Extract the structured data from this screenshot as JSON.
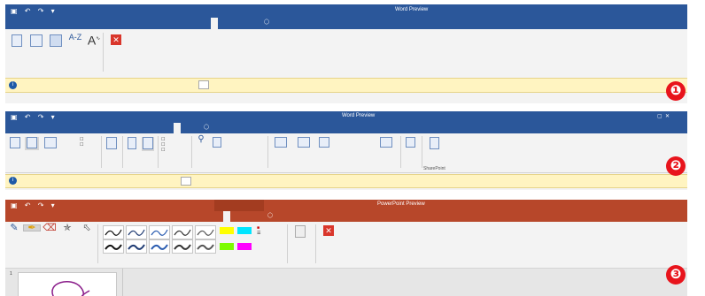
{
  "panel1": {
    "title": "Word Preview",
    "context_header": "",
    "tabs": [
      "",
      "",
      "",
      "",
      "",
      "",
      "",
      "",
      ""
    ],
    "tell_me": "",
    "ribbon": {
      "buttons": [
        "",
        "",
        "",
        "",
        "",
        ""
      ],
      "groups": [
        "",
        ""
      ]
    },
    "message": {
      "label": "",
      "text": "",
      "button": ""
    },
    "badge": "❶"
  },
  "panel2": {
    "title": "Word Preview",
    "tabs": [
      "",
      "",
      "",
      "",
      "",
      "",
      "",
      "",
      ""
    ],
    "tell_me": "",
    "ribbon": {
      "groups": [
        "",
        "",
        "",
        "",
        "",
        "",
        "",
        "SharePoint"
      ]
    },
    "message": {
      "label": "",
      "text": "",
      "button": ""
    },
    "badge": "❷"
  },
  "panel3": {
    "title": "PowerPoint Preview",
    "context_header": "",
    "tabs": [
      "",
      "",
      "",
      "",
      "",
      "",
      "",
      "",
      "",
      ""
    ],
    "tell_me": "",
    "ribbon": {
      "buttons": [
        "",
        "",
        "",
        "",
        "",
        ""
      ],
      "groups": [
        "",
        "",
        "",
        ""
      ],
      "side_items": [
        "",
        ""
      ]
    },
    "badge": "❸"
  },
  "colors": {
    "word_blue": "#2b579a",
    "ppt_orange": "#b7472a",
    "badge_red": "#e8141c",
    "message_bar": "#fff4c1"
  }
}
